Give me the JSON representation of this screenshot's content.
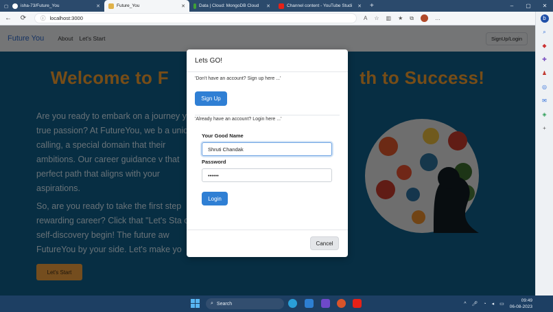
{
  "browser": {
    "tabs": [
      {
        "title": "isha-73/Future_You",
        "icon": "github-icon",
        "color": "#ffffff"
      },
      {
        "title": "Future_You",
        "icon": "page-icon",
        "color": "#e0b24a",
        "active": true
      },
      {
        "title": "Data | Cloud: MongoDB Cloud",
        "icon": "mongodb-icon",
        "color": "#3fa037"
      },
      {
        "title": "Channel content - YouTube Studi",
        "icon": "youtube-icon",
        "color": "#e62117"
      }
    ],
    "window_controls": {
      "minimize": "–",
      "maximize": "▢",
      "close": "✕"
    },
    "address": "localhost:3000",
    "back_glyph": "←",
    "reload_glyph": "⟳",
    "info_glyph": "ⓘ",
    "new_tab_glyph": "+"
  },
  "site": {
    "brand": "Future You",
    "nav_links": [
      "About",
      "Let's Start"
    ],
    "auth_button": "SignUp/Login",
    "hero_title": "Welcome to F                                     th to Success!",
    "paragraph1": "Are you ready to embark on a journey your true passion? At FutureYou, we b a unique calling, a special domain that their ambitions. Our career guidance v that perfect path that aligns with your aspirations.",
    "paragraph2": "So, are you ready to take the first step rewarding career? Click that \"Let's Sta of self-discovery begin! The future aw FutureYou by your side. Let's make yo",
    "start_button": "Let's Start"
  },
  "modal": {
    "title": "Lets GO!",
    "signup_prompt": "'Don't have an account? Sign up here ...'",
    "signup_button": "Sign Up",
    "login_prompt": "'Already have an account? Login here ...'",
    "name_label": "Your Good Name",
    "name_value": "Shruti Chandak",
    "password_label": "Password",
    "password_value": "••••••",
    "login_button": "Login",
    "cancel_button": "Cancel"
  },
  "taskbar": {
    "search_label": "Search",
    "time": "09:49",
    "date": "06-08-2023",
    "accent": "#1d3f63"
  }
}
